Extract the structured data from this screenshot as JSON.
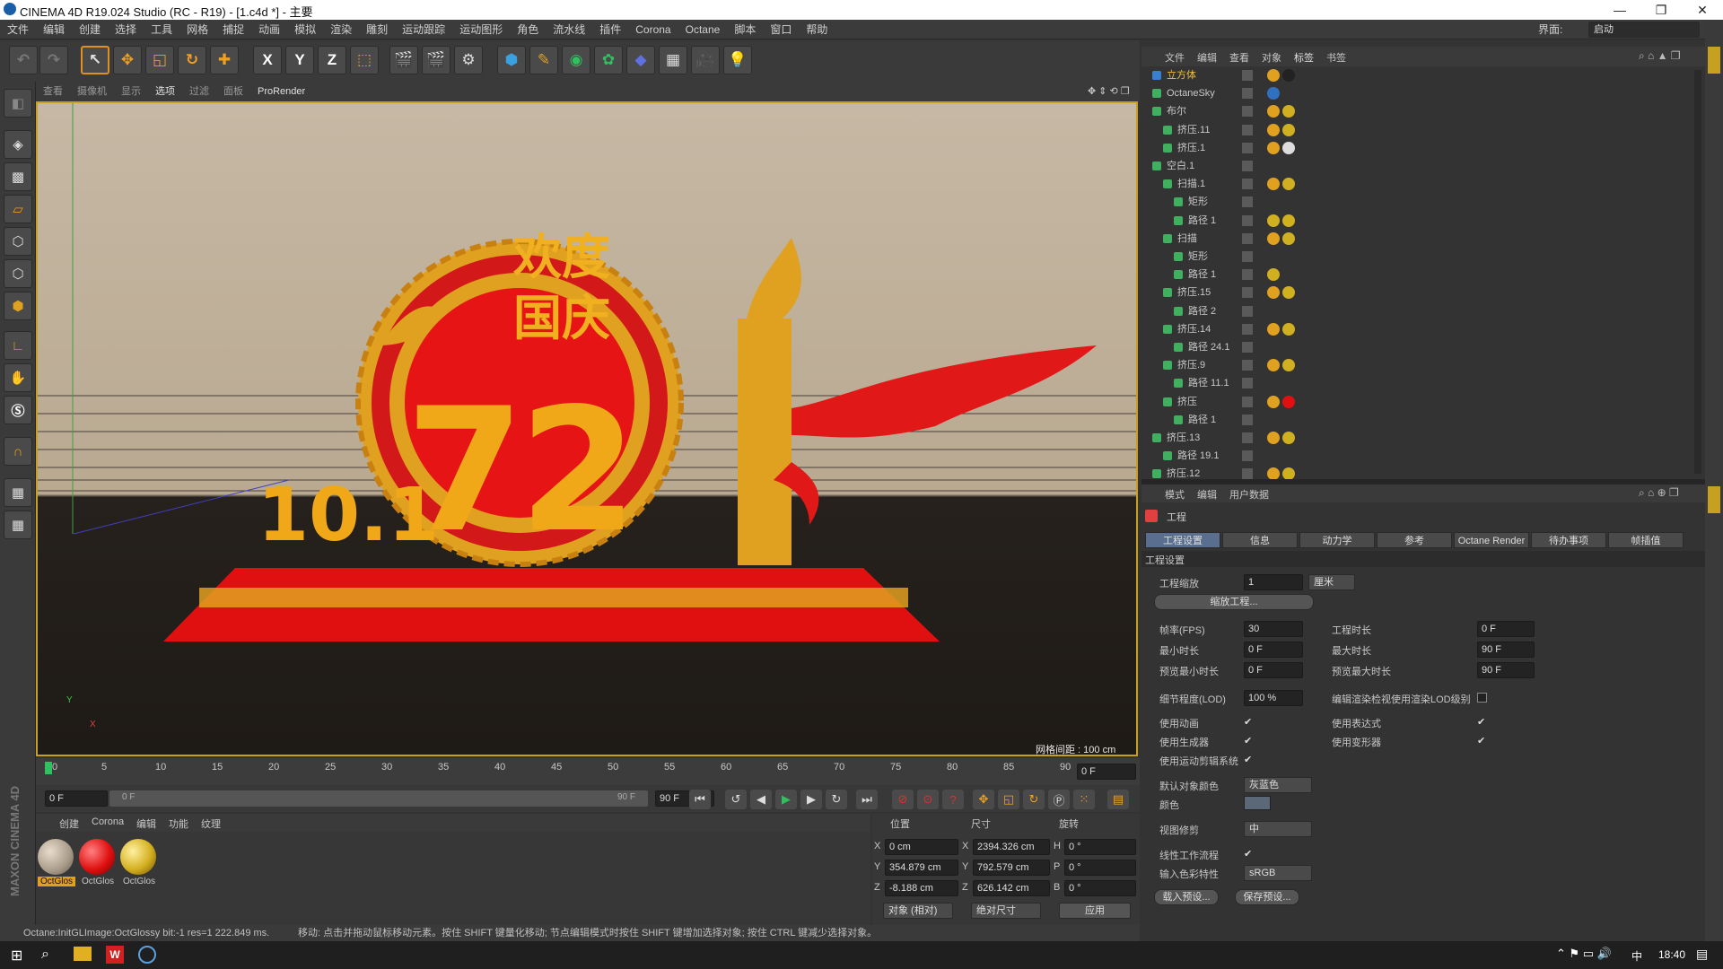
{
  "app": {
    "title": "CINEMA 4D R19.024 Studio (RC - R19) - [1.c4d *] - 主要",
    "window_controls": {
      "minimize": "—",
      "restore": "❐",
      "close": "✕"
    }
  },
  "menubar": [
    "文件",
    "编辑",
    "创建",
    "选择",
    "工具",
    "网格",
    "捕捉",
    "动画",
    "模拟",
    "渲染",
    "雕刻",
    "运动跟踪",
    "运动图形",
    "角色",
    "流水线",
    "插件",
    "Corona",
    "Octane",
    "脚本",
    "窗口",
    "帮助"
  ],
  "layout": {
    "label": "界面:",
    "value": "启动"
  },
  "toolbar": {
    "x": "X",
    "y": "Y",
    "z": "Z"
  },
  "viewport": {
    "menu": [
      "查看",
      "摄像机",
      "显示",
      "选项",
      "过滤",
      "面板",
      "ProRender"
    ],
    "grid_spacing": "网格间距 : 100 cm",
    "axis_y": "Y",
    "axis_x": "X",
    "scene_text": {
      "line1": "欢度",
      "line2": "国庆",
      "number": "72",
      "date": "10.1"
    }
  },
  "timeline": {
    "ticks": [
      "0",
      "5",
      "10",
      "15",
      "20",
      "25",
      "30",
      "35",
      "40",
      "45",
      "50",
      "55",
      "60",
      "65",
      "70",
      "75",
      "80",
      "85",
      "90"
    ],
    "current_frame": "0 F",
    "start": "0 F",
    "range_start": "0 F",
    "range_end": "90 F",
    "end": "90 F"
  },
  "materials": {
    "menu": [
      "创建",
      "Corona",
      "编辑",
      "功能",
      "纹理"
    ],
    "items": [
      {
        "label": "OctGlos",
        "color": "#a89a88"
      },
      {
        "label": "OctGlos",
        "color": "#e01010"
      },
      {
        "label": "OctGlos",
        "color": "#d4b020"
      }
    ],
    "brand": "MAXON CINEMA 4D"
  },
  "coordinates": {
    "headers": [
      "位置",
      "尺寸",
      "旋转"
    ],
    "rows": [
      {
        "axis": "X",
        "pos": "0 cm",
        "size_axis": "X",
        "size": "2394.326 cm",
        "rot_axis": "H",
        "rot": "0 °"
      },
      {
        "axis": "Y",
        "pos": "354.879 cm",
        "size_axis": "Y",
        "size": "792.579 cm",
        "rot_axis": "P",
        "rot": "0 °"
      },
      {
        "axis": "Z",
        "pos": "-8.188 cm",
        "size_axis": "Z",
        "size": "626.142 cm",
        "rot_axis": "B",
        "rot": "0 °"
      }
    ],
    "mode": "对象 (相对)",
    "size_mode": "绝对尺寸",
    "apply": "应用"
  },
  "statusbar": {
    "left": "Octane:InitGLImage:OctGlossy  bit:-1 res=1  222.849 ms.",
    "right": "移动: 点击并拖动鼠标移动元素。按住 SHIFT 键量化移动; 节点编辑模式时按住 SHIFT 键增加选择对象; 按住 CTRL 键减少选择对象。"
  },
  "object_manager": {
    "menu": [
      "文件",
      "编辑",
      "查看",
      "对象",
      "标签",
      "书签"
    ],
    "objects": [
      {
        "name": "立方体",
        "indent": 0,
        "highlight": true
      },
      {
        "name": "OctaneSky",
        "indent": 0
      },
      {
        "name": "布尔",
        "indent": 0
      },
      {
        "name": "挤压.11",
        "indent": 1
      },
      {
        "name": "挤压.1",
        "indent": 1
      },
      {
        "name": "空白.1",
        "indent": 0
      },
      {
        "name": "扫描.1",
        "indent": 1
      },
      {
        "name": "矩形",
        "indent": 2
      },
      {
        "name": "路径 1",
        "indent": 2
      },
      {
        "name": "扫描",
        "indent": 1
      },
      {
        "name": "矩形",
        "indent": 2
      },
      {
        "name": "路径 1",
        "indent": 2
      },
      {
        "name": "挤压.15",
        "indent": 1
      },
      {
        "name": "路径 2",
        "indent": 2
      },
      {
        "name": "挤压.14",
        "indent": 1
      },
      {
        "name": "路径 24.1",
        "indent": 2
      },
      {
        "name": "挤压.9",
        "indent": 1
      },
      {
        "name": "路径 11.1",
        "indent": 2
      },
      {
        "name": "挤压",
        "indent": 1
      },
      {
        "name": "路径 1",
        "indent": 2
      },
      {
        "name": "挤压.13",
        "indent": 0
      },
      {
        "name": "路径 19.1",
        "indent": 1
      },
      {
        "name": "挤压.12",
        "indent": 0
      }
    ]
  },
  "attributes": {
    "menu": [
      "模式",
      "编辑",
      "用户数据"
    ],
    "title": "工程",
    "tabs": [
      "工程设置",
      "信息",
      "动力学",
      "参考",
      "Octane Render",
      "待办事项",
      "帧插值"
    ],
    "section": "工程设置",
    "project_scale_label": "工程缩放",
    "project_scale_value": "1",
    "project_scale_unit": "厘米",
    "scale_button": "缩放工程...",
    "fields": [
      {
        "label": "帧率(FPS)",
        "value": "30"
      },
      {
        "label": "最小时长",
        "value": "0 F"
      },
      {
        "label": "预览最小时长",
        "value": "0 F"
      },
      {
        "label": "工程时长",
        "value": "0 F"
      },
      {
        "label": "最大时长",
        "value": "90 F"
      },
      {
        "label": "预览最大时长",
        "value": "90 F"
      }
    ],
    "lod_label": "细节程度(LOD)",
    "lod_value": "100 %",
    "lod_render_label": "编辑渲染检视使用渲染LOD级别",
    "checks": [
      {
        "label": "使用动画",
        "checked": "✔"
      },
      {
        "label": "使用生成器",
        "checked": "✔"
      },
      {
        "label": "使用运动剪辑系统",
        "checked": "✔"
      },
      {
        "label": "使用表达式",
        "checked": "✔"
      },
      {
        "label": "使用变形器",
        "checked": "✔"
      }
    ],
    "default_color_label": "默认对象颜色",
    "default_color_value": "灰蓝色",
    "color_label": "颜色",
    "view_clip_label": "视图修剪",
    "view_clip_value": "中",
    "linear_label": "线性工作流程",
    "input_color_label": "输入色彩特性",
    "input_color_value": "sRGB",
    "load_preset": "载入预设...",
    "save_preset": "保存预设..."
  },
  "taskbar": {
    "time": "18:40",
    "ime": "中"
  }
}
